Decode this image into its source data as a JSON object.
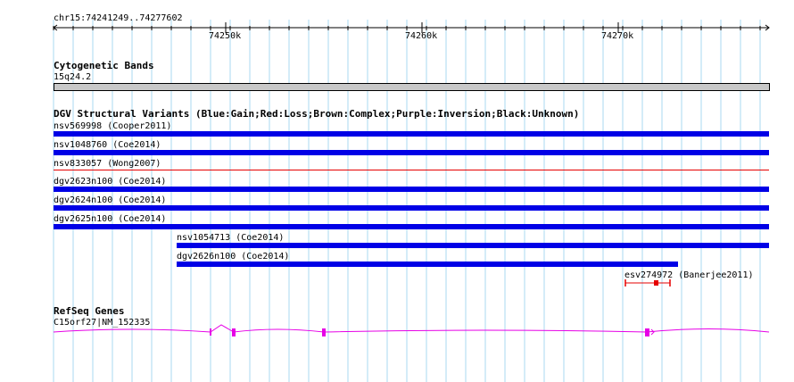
{
  "ruler": {
    "range_label": "chr15:74241249..74277602",
    "ticks": [
      "74250k",
      "74260k",
      "74270k"
    ]
  },
  "cytoband": {
    "title": "Cytogenetic Bands",
    "band": "15q24.2"
  },
  "dgv": {
    "title": "DGV Structural Variants (Blue:Gain;Red:Loss;Brown:Complex;Purple:Inversion;Black:Unknown)",
    "variants": [
      {
        "label": "nsv569998 (Cooper2011)",
        "type": "gain"
      },
      {
        "label": "nsv1048760 (Coe2014)",
        "type": "gain"
      },
      {
        "label": "nsv833057 (Wong2007)",
        "type": "loss"
      },
      {
        "label": "dgv2623n100 (Coe2014)",
        "type": "gain"
      },
      {
        "label": "dgv2624n100 (Coe2014)",
        "type": "gain"
      },
      {
        "label": "dgv2625n100 (Coe2014)",
        "type": "gain"
      },
      {
        "label": "nsv1054713 (Coe2014)",
        "type": "gain"
      },
      {
        "label": "dgv2626n100 (Coe2014)",
        "type": "gain"
      },
      {
        "label": "esv274972 (Banerjee2011)",
        "type": "loss"
      }
    ]
  },
  "refseq": {
    "title": "RefSeq Genes",
    "gene_label": "C15orf27|NM_152335"
  },
  "colors": {
    "gain": "#0000e6",
    "loss": "#e60000",
    "gene": "#e600e6",
    "grid": "#a8d8f0",
    "band": "#c8c8c8"
  }
}
